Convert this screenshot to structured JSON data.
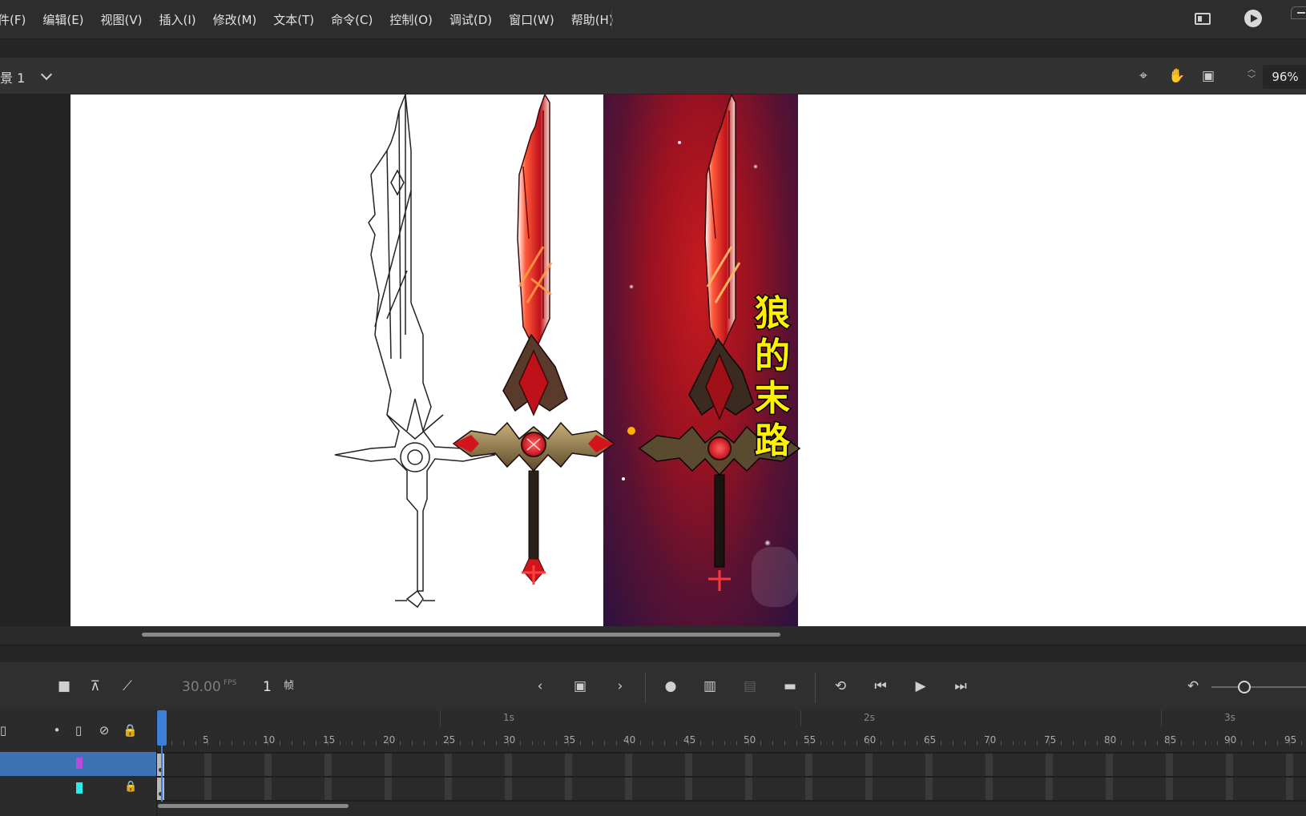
{
  "menu": {
    "items": [
      "件(F)",
      "编辑(E)",
      "视图(V)",
      "插入(I)",
      "修改(M)",
      "文本(T)",
      "命令(C)",
      "控制(O)",
      "调试(D)",
      "窗口(W)",
      "帮助(H)"
    ]
  },
  "editbar": {
    "scene_label": "景 1",
    "zoom": "96%"
  },
  "stage": {
    "caption": "狼的末路",
    "colors": {
      "blade_red": "#d4141c",
      "flame": "#ff7a2a",
      "hilt_gold": "#8c7a4a",
      "panel_bg": "#9c1221",
      "caption_yellow": "#fff000"
    }
  },
  "timeline": {
    "fps_value": "30.00",
    "fps_unit": "FPS",
    "current_frame": "1",
    "frame_unit": "帧",
    "seconds": [
      "1s",
      "2s",
      "3s"
    ],
    "frame_numbers": [
      "5",
      "10",
      "15",
      "20",
      "25",
      "30",
      "35",
      "40",
      "45",
      "50",
      "55",
      "60",
      "65",
      "70",
      "75",
      "80",
      "85",
      "90",
      "95"
    ],
    "layers": [
      {
        "color": "#b84bdb",
        "selected": true,
        "locked": false
      },
      {
        "color": "#2ee8e8",
        "selected": false,
        "locked": true
      }
    ]
  }
}
